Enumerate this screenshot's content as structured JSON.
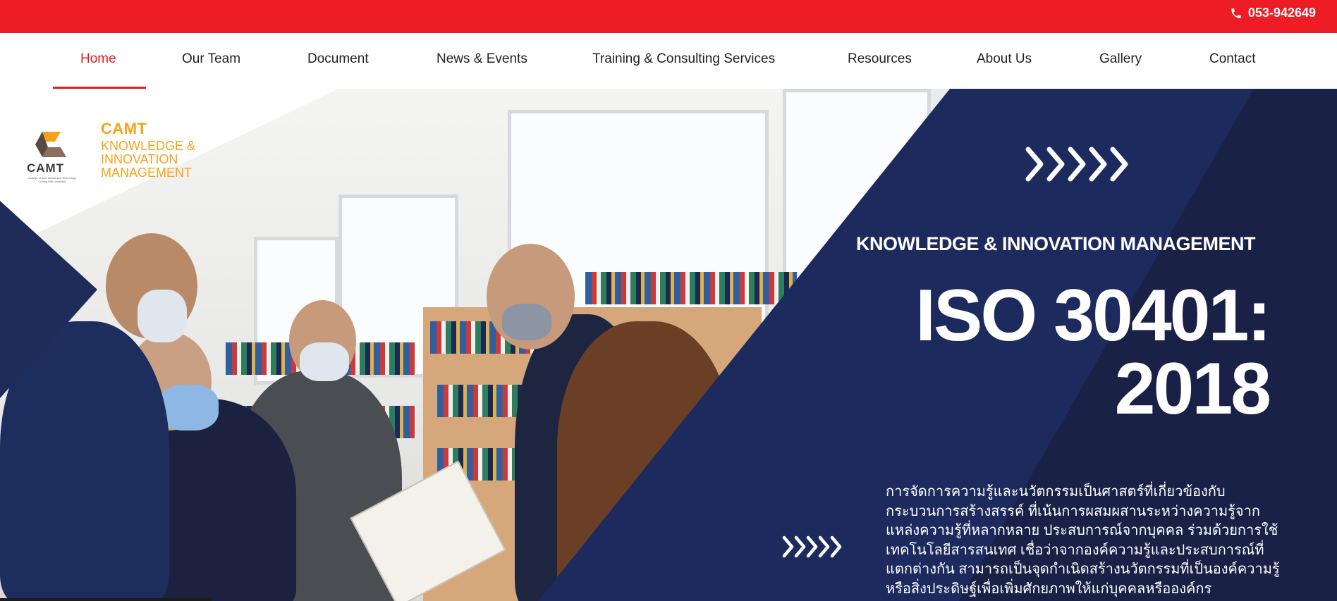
{
  "topbar": {
    "phone_icon": "phone-icon",
    "phone": "053-942649",
    "color": "#ee1c25"
  },
  "nav": {
    "items": [
      {
        "label": "Home",
        "active": true
      },
      {
        "label": "Our Team"
      },
      {
        "label": "Document"
      },
      {
        "label": "News & Events"
      },
      {
        "label": "Training & Consulting Services"
      },
      {
        "label": "Resources"
      },
      {
        "label": "About Us"
      },
      {
        "label": "Gallery"
      },
      {
        "label": "Contact"
      }
    ],
    "active_color": "#e31b23"
  },
  "logo": {
    "mark_text": "CAMT",
    "caption": "College of Arts, Media and Technology Chiang Mai University",
    "title": "CAMT",
    "subtitle_lines": [
      "KNOWLEDGE &",
      "INNOVATION",
      "MANAGEMENT"
    ],
    "color": "#f7a21b"
  },
  "hero": {
    "kicker": "KNOWLEDGE & INNOVATION MANAGEMENT",
    "title_line1": "ISO 30401:",
    "title_line2": "2018",
    "description": "การจัดการความรู้และนวัตกรรมเป็นศาสตร์ที่เกี่ยวข้องกับกระบวนการสร้างสรรค์ ที่เน้นการผสมผสานระหว่างความรู้จากแหล่งความรู้ที่หลากหลาย ประสบการณ์จากบุคคล ร่วมด้วยการใช้เทคโนโลยีสารสนเทศ เชื่อว่าจากองค์ความรู้และประสบการณ์ที่แตกต่างกัน สามารถเป็นจุดกำเนิดสร้างนวัตกรรมที่เป็นองค์ความรู้หรือสิ่งประดิษฐ์เพื่อเพิ่มศักยภาพให้แก่บุคคลหรือองค์กร",
    "navy": "#1c2a5e",
    "navy_dark": "#1a2147",
    "chevrons_icon": "chevrons-right-icon"
  }
}
